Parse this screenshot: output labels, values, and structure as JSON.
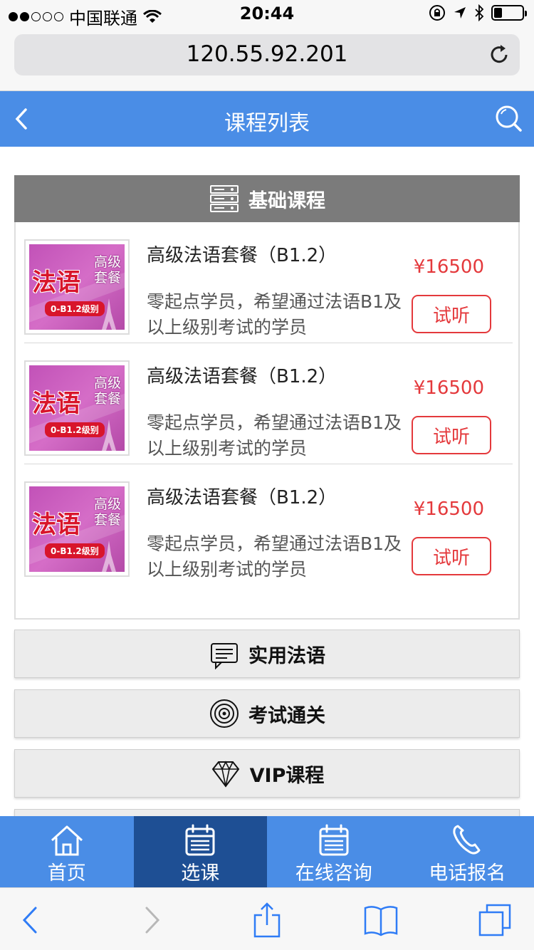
{
  "status_bar": {
    "carrier": "中国联通",
    "time": "20:44",
    "battery_level": 0.3
  },
  "browser": {
    "url": "120.55.92.201"
  },
  "header": {
    "title": "课程列表"
  },
  "sections": {
    "basic": {
      "label": "基础课程",
      "icon": "server-stack-icon"
    },
    "practical": {
      "label": "实用法语",
      "icon": "chat-bubble-icon"
    },
    "exam": {
      "label": "考试通关",
      "icon": "target-icon"
    },
    "vip": {
      "label": "VIP课程",
      "icon": "diamond-icon"
    }
  },
  "thumbnail": {
    "main_text": "法语",
    "side_text": "高级套餐",
    "tag_text": "0-B1.2级别"
  },
  "courses": [
    {
      "title": "高级法语套餐（B1.2）",
      "description": "零起点学员，希望通过法语B1及以上级别考试的学员",
      "price": "¥16500",
      "trial_label": "试听"
    },
    {
      "title": "高级法语套餐（B1.2）",
      "description": "零起点学员，希望通过法语B1及以上级别考试的学员",
      "price": "¥16500",
      "trial_label": "试听"
    },
    {
      "title": "高级法语套餐（B1.2）",
      "description": "零起点学员，希望通过法语B1及以上级别考试的学员",
      "price": "¥16500",
      "trial_label": "试听"
    }
  ],
  "bottom_nav": [
    {
      "label": "首页",
      "icon": "home-icon",
      "active": false
    },
    {
      "label": "选课",
      "icon": "calendar-icon",
      "active": true
    },
    {
      "label": "在线咨询",
      "icon": "calendar-icon",
      "active": false
    },
    {
      "label": "电话报名",
      "icon": "phone-icon",
      "active": false
    }
  ],
  "colors": {
    "primary": "#4a8de6",
    "nav_active": "#1e4f94",
    "price_red": "#e4393c",
    "section_active_bg": "#7b7b7b"
  }
}
